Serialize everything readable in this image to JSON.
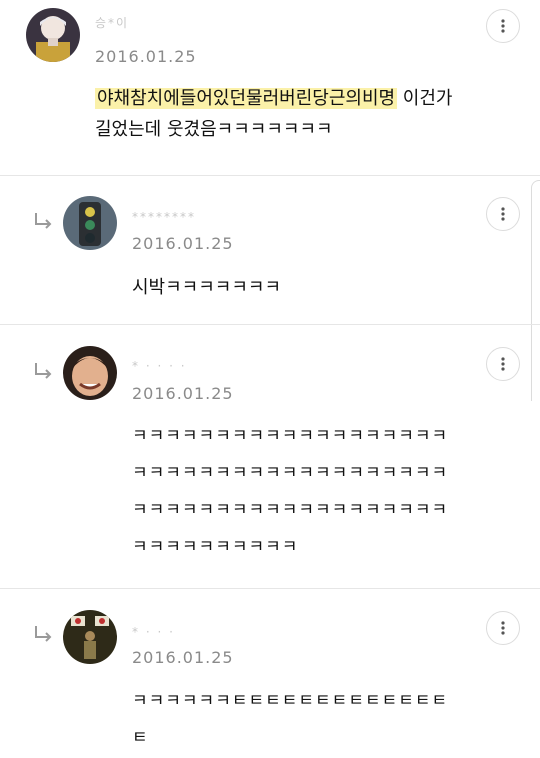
{
  "comments": [
    {
      "name": "승*이",
      "date": "2016.01.25",
      "highlight": "야채참치에들어있던물러버린당근의비명",
      "text_after": " 이건가",
      "line2": "길었는데 웃겼음ㅋㅋㅋㅋㅋㅋㅋ"
    },
    {
      "name": "********",
      "date": "2016.01.25",
      "text": "시박ㅋㅋㅋㅋㅋㅋㅋ"
    },
    {
      "name": "*  ·  ·  ·  ·",
      "date": "2016.01.25",
      "lines": [
        "ㅋㅋㅋㅋㅋㅋㅋㅋㅋㅋㅋㅋㅋㅋㅋㅋㅋㅋㅋ",
        "ㅋㅋㅋㅋㅋㅋㅋㅋㅋㅋㅋㅋㅋㅋㅋㅋㅋㅋㅋ",
        "ㅋㅋㅋㅋㅋㅋㅋㅋㅋㅋㅋㅋㅋㅋㅋㅋㅋㅋㅋ",
        "ㅋㅋㅋㅋㅋㅋㅋㅋㅋㅋ"
      ]
    },
    {
      "name": "*                       ·  ·  ·",
      "date": "2016.01.25",
      "lines": [
        "ㅋㅋㅋㅋㅋㅋㅌㅌㅌㅌㅌㅌㅌㅌㅌㅌㅌㅌㅌ",
        "ㅌ"
      ]
    }
  ],
  "icons": {
    "more": "more-vertical-icon",
    "reply": "reply-arrow-icon"
  },
  "colors": {
    "highlight": "#fbf1a9",
    "date": "#8a8a8a",
    "divider": "#e6e6e6"
  }
}
